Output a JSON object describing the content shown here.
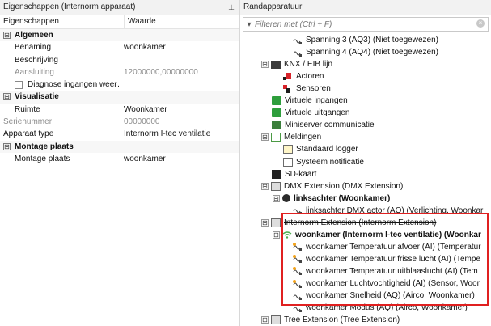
{
  "left": {
    "title": "Eigenschappen (Internorm apparaat)",
    "pin_icon": "pin-icon",
    "columns": {
      "key": "Eigenschappen",
      "value": "Waarde"
    },
    "rows": [
      {
        "type": "category",
        "label": "Algemeen",
        "toggle": "⊟"
      },
      {
        "type": "prop",
        "label": "Benaming",
        "value": "woonkamer",
        "indent": true
      },
      {
        "type": "prop",
        "label": "Beschrijving",
        "value": "",
        "indent": true
      },
      {
        "type": "prop",
        "label": "Aansluiting",
        "value": "12000000,00000000",
        "indent": true,
        "gray": true
      },
      {
        "type": "check",
        "label": "Diagnose ingangen weer…",
        "value": "",
        "indent": true
      },
      {
        "type": "category",
        "label": "Visualisatie",
        "toggle": "⊟"
      },
      {
        "type": "prop",
        "label": "Ruimte",
        "value": "Woonkamer",
        "indent": true
      },
      {
        "type": "prop",
        "label": "Serienummer",
        "value": "00000000",
        "indent": false,
        "gray": true
      },
      {
        "type": "prop",
        "label": "Apparaat type",
        "value": "Internorm I-tec ventilatie",
        "indent": false
      },
      {
        "type": "category",
        "label": "Montage plaats",
        "toggle": "⊟"
      },
      {
        "type": "prop",
        "label": "Montage plaats",
        "value": "woonkamer",
        "indent": true
      }
    ]
  },
  "right": {
    "title": "Randapparatuur",
    "filter_placeholder": "Filteren met (Ctrl + F)",
    "clear_icon": "×",
    "tree": [
      {
        "label": "Spanning 3 (AQ3) (Niet toegewezen)",
        "icon": "analog-out",
        "level": 3,
        "toggle": ""
      },
      {
        "label": "Spanning 4 (AQ4) (Niet toegewezen)",
        "icon": "analog-out",
        "level": 3,
        "toggle": ""
      },
      {
        "label": "KNX / EIB lijn",
        "icon": "device",
        "level": 1,
        "toggle": "⊟"
      },
      {
        "label": "Actoren",
        "icon": "actor",
        "level": 2,
        "toggle": ""
      },
      {
        "label": "Sensoren",
        "icon": "sensor-group",
        "level": 2,
        "toggle": ""
      },
      {
        "label": "Virtuele ingangen",
        "icon": "virtual-in",
        "level": 1,
        "toggle": ""
      },
      {
        "label": "Virtuele uitgangen",
        "icon": "virtual-out",
        "level": 1,
        "toggle": ""
      },
      {
        "label": "Miniserver communicatie",
        "icon": "miniserver",
        "level": 1,
        "toggle": ""
      },
      {
        "label": "Meldingen",
        "icon": "messages",
        "level": 1,
        "toggle": "⊟"
      },
      {
        "label": "Standaard logger",
        "icon": "logger",
        "level": 2,
        "toggle": ""
      },
      {
        "label": "Systeem notificatie",
        "icon": "notification",
        "level": 2,
        "toggle": ""
      },
      {
        "label": "SD-kaart",
        "icon": "sd-card",
        "level": 1,
        "toggle": ""
      },
      {
        "label": "DMX Extension (DMX Extension)",
        "icon": "extension",
        "level": 1,
        "toggle": "⊟"
      },
      {
        "label": "linksachter (Woonkamer)",
        "icon": "link",
        "level": 2,
        "toggle": "⊟",
        "bold": true
      },
      {
        "label": "linksachter DMX actor (AQ) (Verlichting, Woonkar",
        "icon": "analog-out",
        "level": 3,
        "toggle": ""
      },
      {
        "label": "Internorm Extension (Internorm Extension)",
        "icon": "extension",
        "level": 1,
        "toggle": "⊟",
        "strike": true
      },
      {
        "label": "woonkamer (Internorm I-tec ventilatie) (Woonkar",
        "icon": "wifi",
        "level": 2,
        "toggle": "⊟",
        "bold": true
      },
      {
        "label": "woonkamer Temperatuur afvoer (AI) (Temperatur",
        "icon": "analog-in",
        "level": 3,
        "toggle": ""
      },
      {
        "label": "woonkamer Temperatuur frisse lucht (AI) (Tempe",
        "icon": "analog-in",
        "level": 3,
        "toggle": ""
      },
      {
        "label": "woonkamer Temperatuur uitblaaslucht (AI) (Tem",
        "icon": "analog-in",
        "level": 3,
        "toggle": ""
      },
      {
        "label": "woonkamer Luchtvochtigheid (AI) (Sensor, Woor",
        "icon": "analog-in",
        "level": 3,
        "toggle": ""
      },
      {
        "label": "woonkamer Snelheid (AQ) (Airco, Woonkamer)",
        "icon": "analog-out",
        "level": 3,
        "toggle": ""
      },
      {
        "label": "woonkamer Modus (AQ) (Airco, Woonkamer)",
        "icon": "analog-out",
        "level": 3,
        "toggle": ""
      },
      {
        "label": "Tree Extension (Tree Extension)",
        "icon": "extension",
        "level": 1,
        "toggle": "⊞"
      }
    ],
    "highlight_color": "#e02020"
  }
}
